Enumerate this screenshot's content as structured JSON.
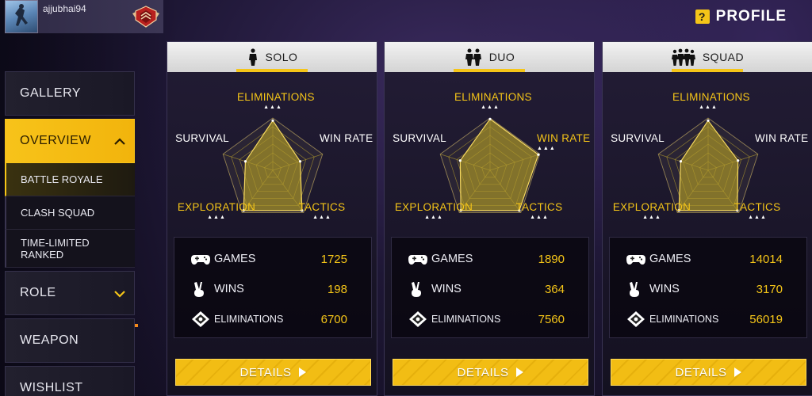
{
  "player": {
    "username": "ajjubhai94",
    "avatar_icon": "player-avatar",
    "rank_icon": "rank-badge-icon"
  },
  "header": {
    "profile_label": "PROFILE",
    "help_icon": "?"
  },
  "sidebar": {
    "items": [
      {
        "label": "GALLERY"
      },
      {
        "label": "OVERVIEW"
      },
      {
        "label": "ROLE"
      },
      {
        "label": "WEAPON"
      },
      {
        "label": "WISHLIST"
      }
    ],
    "subitems": [
      {
        "label": "BATTLE ROYALE"
      },
      {
        "label": "CLASH SQUAD"
      },
      {
        "label": "TIME-LIMITED RANKED"
      }
    ]
  },
  "radar_labels": {
    "eliminations": "ELIMINATIONS",
    "win_rate": "WIN RATE",
    "survival": "SURVIVAL",
    "exploration": "EXPLORATION",
    "tactics": "TACTICS"
  },
  "stat_labels": {
    "games": "GAMES",
    "wins": "WINS",
    "eliminations": "ELIMINATIONS"
  },
  "modes": [
    {
      "title": "SOLO",
      "highlight": [
        "eliminations",
        "exploration",
        "tactics"
      ],
      "radar": {
        "eliminations": 0.95,
        "win_rate": 0.55,
        "tactics": 0.95,
        "exploration": 0.95,
        "survival": 0.55
      },
      "games": "1725",
      "wins": "198",
      "eliminations": "6700",
      "details_label": "DETAILS"
    },
    {
      "title": "DUO",
      "highlight": [
        "eliminations",
        "win_rate",
        "exploration",
        "tactics"
      ],
      "radar": {
        "eliminations": 0.98,
        "win_rate": 0.97,
        "tactics": 0.95,
        "exploration": 0.95,
        "survival": 0.6
      },
      "games": "1890",
      "wins": "364",
      "eliminations": "7560",
      "details_label": "DETAILS"
    },
    {
      "title": "SQUAD",
      "highlight": [
        "eliminations",
        "exploration",
        "tactics"
      ],
      "radar": {
        "eliminations": 0.95,
        "win_rate": 0.6,
        "tactics": 0.95,
        "exploration": 0.95,
        "survival": 0.55
      },
      "games": "14014",
      "wins": "3170",
      "eliminations": "56019",
      "details_label": "DETAILS"
    }
  ],
  "colors": {
    "accent": "#f5c518",
    "radar_fill": "#8a7a2a"
  }
}
